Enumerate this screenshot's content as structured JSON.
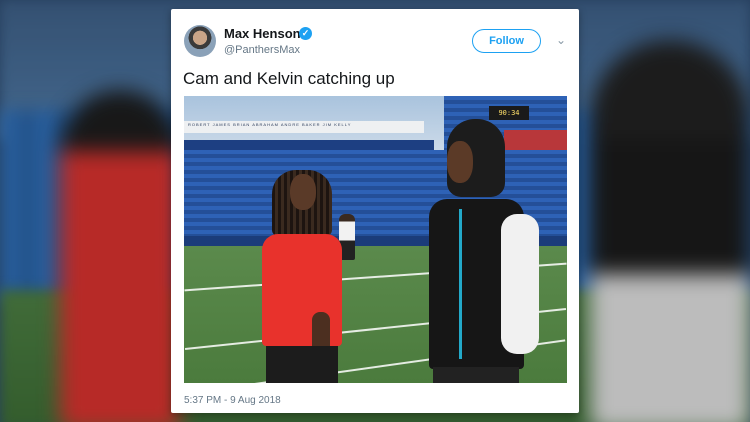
{
  "tweet": {
    "author_name": "Max Henson",
    "handle": "@PanthersMax",
    "verified_glyph": "✓",
    "follow_label": "Follow",
    "menu_glyph": "⌄",
    "text": "Cam and Kelvin catching up",
    "timestamp": "5:37 PM - 9 Aug 2018"
  },
  "photo": {
    "scoreboard": "90:34",
    "press_box_text": "ROBERT JAMES   BRIAN ABRAHAM   ANDRE BAKER   JIM KELLY"
  },
  "colors": {
    "accent": "#1da1f2",
    "red_shirt": "#e8322c"
  }
}
